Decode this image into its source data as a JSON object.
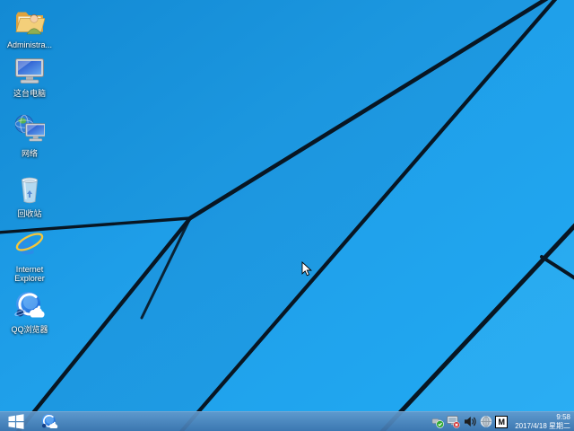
{
  "desktop_icons": [
    {
      "label": "Administra..."
    },
    {
      "label": "这台电脑"
    },
    {
      "label": "网络"
    },
    {
      "label": "回收站"
    },
    {
      "label": "Internet Explorer"
    },
    {
      "label": "QQ浏览器"
    }
  ],
  "taskbar": {
    "tray": {
      "ime_badge": "M",
      "clock_time": "9:58",
      "clock_date": "2017/4/18 星期二"
    }
  },
  "colors": {
    "wallpaper_top_left": "#1692de",
    "wallpaper_bright": "#23a7f0",
    "beam_line": "#081623",
    "taskbar_blue": "#4d87bb"
  }
}
